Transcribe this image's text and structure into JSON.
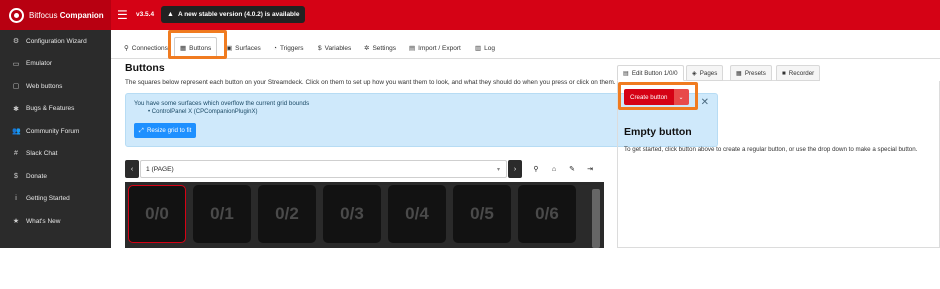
{
  "header": {
    "brand_prefix": "Bitfocus ",
    "brand_name": "Companion",
    "menu_icon": "hamburger-icon",
    "version": "v3.5.4",
    "update_notice": "A new stable version (4.0.2) is available",
    "accent_color": "#d50215"
  },
  "sidebar": {
    "items": [
      {
        "label": "Configuration Wizard",
        "icon": "⚙"
      },
      {
        "label": "Emulator",
        "icon": "▭"
      },
      {
        "label": "Web buttons",
        "icon": "▢"
      },
      {
        "label": "Bugs & Features",
        "icon": "✱"
      },
      {
        "label": "Community Forum",
        "icon": "👥"
      },
      {
        "label": "Slack Chat",
        "icon": "#"
      },
      {
        "label": "Donate",
        "icon": "$"
      },
      {
        "label": "Getting Started",
        "icon": "i"
      },
      {
        "label": "What's New",
        "icon": "★"
      }
    ]
  },
  "tabs": {
    "connections": "Connections",
    "buttons": "Buttons",
    "surfaces": "Surfaces",
    "triggers": "Triggers",
    "variables": "Variables",
    "settings": "Settings",
    "import_export": "Import / Export",
    "log": "Log"
  },
  "buttons_panel": {
    "title": "Buttons",
    "description": "The squares below represent each button on your Streamdeck. Click on them to set up how you want them to look, and what they should do when you press or click on them.",
    "alert_text": "You have some surfaces which overflow the current grid bounds",
    "alert_item": "• ControlPanel X (CPCompanionPluginX)",
    "resize_label": "Resize grid to fit",
    "page_label": "1 (PAGE)",
    "grid_cells": [
      "0/0",
      "0/1",
      "0/2",
      "0/3",
      "0/4",
      "0/5",
      "0/6"
    ]
  },
  "editor_panel": {
    "tabs": {
      "edit_button": "Edit Button 1/0/0",
      "pages": "Pages",
      "presets": "Presets",
      "recorder": "Recorder"
    },
    "create_label": "Create button",
    "empty_title": "Empty button",
    "empty_desc": "To get started, click button above to create a regular button, or use the drop down to make a special button."
  }
}
